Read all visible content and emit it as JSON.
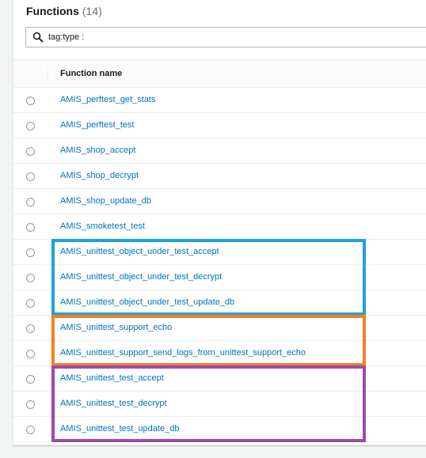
{
  "header": {
    "title": "Functions",
    "count": "(14)"
  },
  "search": {
    "value": "tag:type :"
  },
  "table": {
    "column": "Function name",
    "rows": [
      "AMIS_perftest_get_stats",
      "AMIS_perftest_test",
      "AMIS_shop_accept",
      "AMIS_shop_decrypt",
      "AMIS_shop_update_db",
      "AMIS_smoketest_test",
      "AMIS_unittest_object_under_test_accept",
      "AMIS_unittest_object_under_test_decrypt",
      "AMIS_unittest_object_under_test_update_db",
      "AMIS_unittest_support_echo",
      "AMIS_unittest_support_send_logs_from_unittest_support_echo",
      "AMIS_unittest_test_accept",
      "AMIS_unittest_test_decrypt",
      "AMIS_unittest_test_update_db"
    ]
  },
  "highlight_groups": [
    {
      "color": "#1ea1e0",
      "first_row": 6,
      "last_row": 8
    },
    {
      "color": "#f48024",
      "first_row": 9,
      "last_row": 10
    },
    {
      "color": "#9b4aa8",
      "first_row": 11,
      "last_row": 13
    }
  ]
}
